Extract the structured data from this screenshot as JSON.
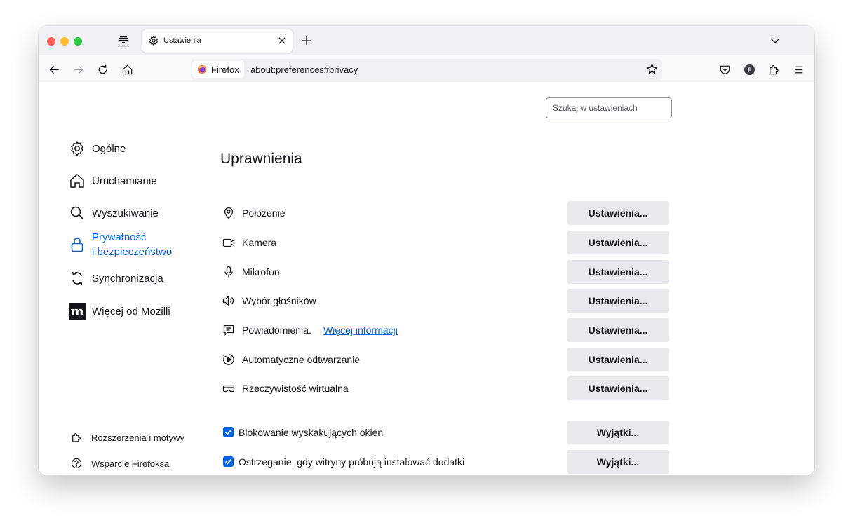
{
  "tab": {
    "title": "Ustawienia"
  },
  "urlbar": {
    "identity": "Firefox",
    "url": "about:preferences#privacy"
  },
  "search": {
    "placeholder": "Szukaj w ustawieniach"
  },
  "sidebar": {
    "categories": [
      {
        "label": "Ogólne",
        "icon": "gear-icon"
      },
      {
        "label": "Uruchamianie",
        "icon": "home-icon"
      },
      {
        "label": "Wyszukiwanie",
        "icon": "search-icon"
      },
      {
        "label_line1": "Prywatność",
        "label_line2": "i bezpieczeństwo",
        "icon": "lock-icon",
        "active": true
      },
      {
        "label": "Synchronizacja",
        "icon": "sync-icon"
      },
      {
        "label": "Więcej od Mozilli",
        "icon": "mozilla-icon"
      }
    ],
    "footer": [
      {
        "label": "Rozszerzenia i motywy",
        "icon": "extensions-icon"
      },
      {
        "label": "Wsparcie Firefoksa",
        "icon": "help-icon"
      }
    ]
  },
  "permissions": {
    "heading": "Uprawnienia",
    "rows": [
      {
        "label": "Położenie",
        "icon": "location-icon",
        "button": "Ustawienia..."
      },
      {
        "label": "Kamera",
        "icon": "camera-icon",
        "button": "Ustawienia..."
      },
      {
        "label": "Mikrofon",
        "icon": "microphone-icon",
        "button": "Ustawienia..."
      },
      {
        "label": "Wybór głośników",
        "icon": "speaker-icon",
        "button": "Ustawienia..."
      },
      {
        "label": "Powiadomienia.",
        "link": "Więcej informacji",
        "icon": "notification-icon",
        "button": "Ustawienia..."
      },
      {
        "label": "Automatyczne odtwarzanie",
        "icon": "autoplay-icon",
        "button": "Ustawienia..."
      },
      {
        "label": "Rzeczywistość wirtualna",
        "icon": "vr-icon",
        "button": "Ustawienia..."
      }
    ],
    "checks": [
      {
        "label": "Blokowanie wyskakujących okien",
        "checked": true,
        "button": "Wyjątki..."
      },
      {
        "label": "Ostrzeganie, gdy witryny próbują instalować dodatki",
        "checked": true,
        "button": "Wyjątki..."
      }
    ]
  },
  "colors": {
    "accent": "#0061e0",
    "button_bg": "#e9e9ed",
    "toolbar_bg": "#f9f9fb",
    "tabstrip_bg": "#f0f0f4"
  }
}
